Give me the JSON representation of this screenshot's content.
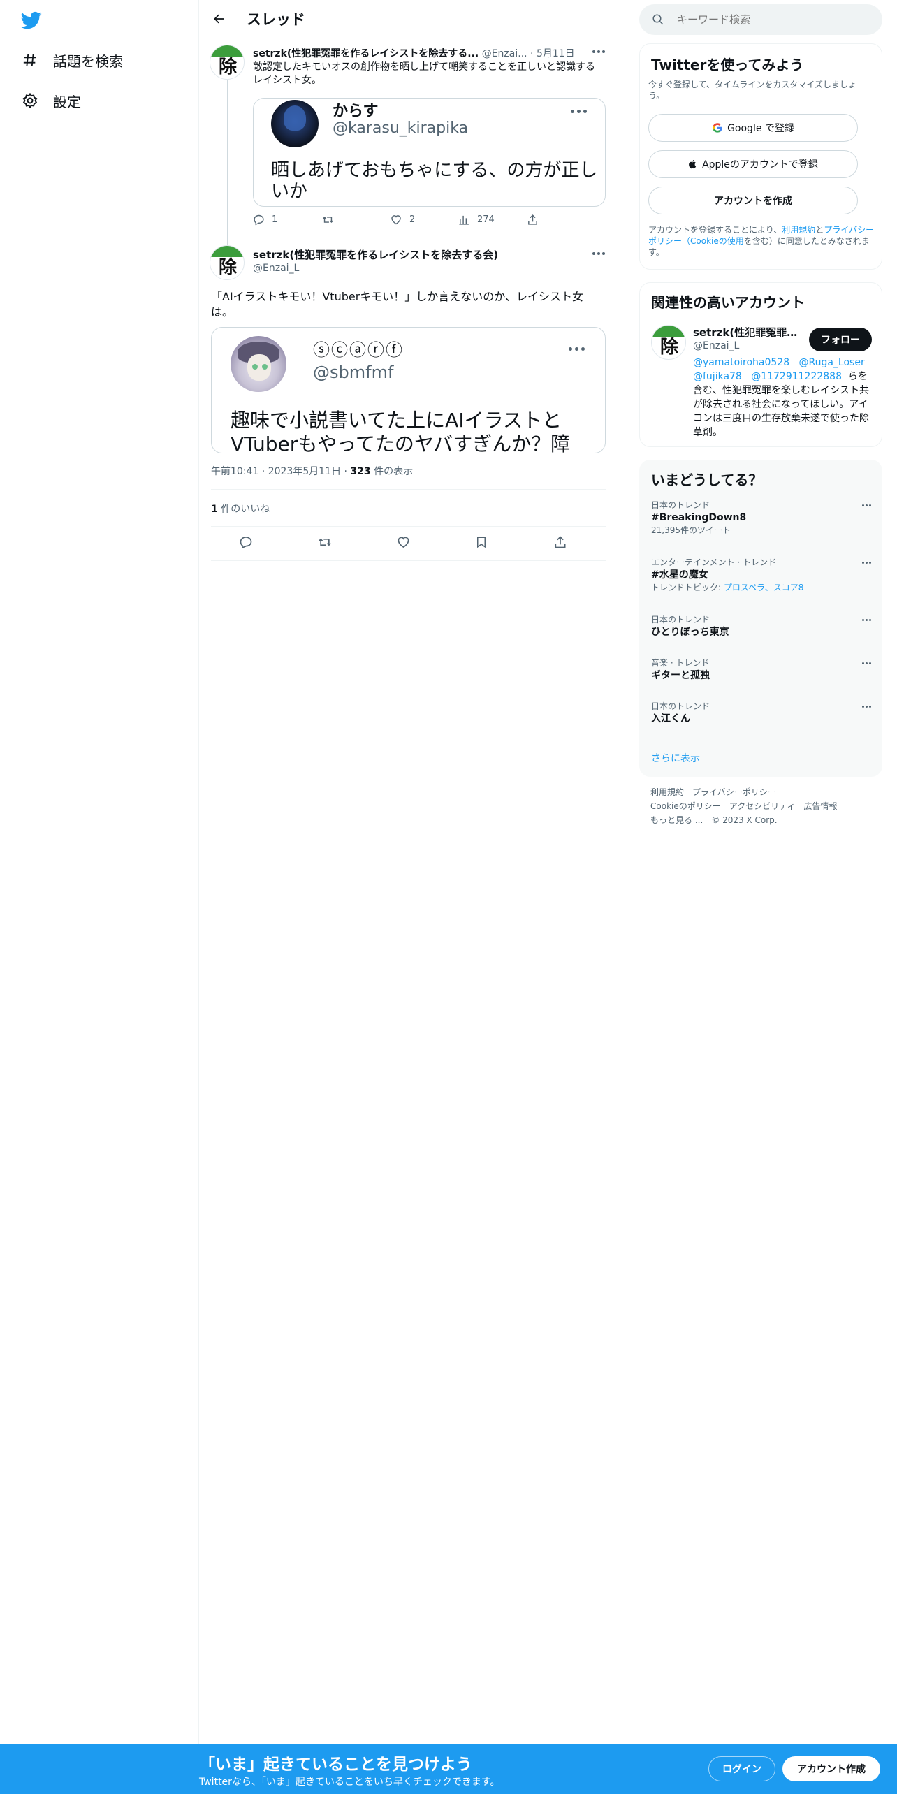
{
  "nav": {
    "logo_icon": "twitter-bird-icon",
    "items": [
      {
        "label": "話題を検索",
        "icon": "hashtag-icon"
      },
      {
        "label": "設定",
        "icon": "gear-icon"
      }
    ]
  },
  "thread": {
    "title": "スレッド",
    "tweet1": {
      "author_name": "setrzk(性犯罪冤罪を作るレイシストを除去する...",
      "handle": "@Enzai...",
      "date": "· 5月11日",
      "text": "敵認定したキモいオスの創作物を晒し上げて嘲笑することを正しいと認識するレイシスト女。",
      "quote": {
        "name": "からす",
        "handle": "@karasu_kirapika",
        "text": "晒しあげておもちゃにする、の方が正しいか"
      },
      "reply_count": "1",
      "retweet_count": "",
      "like_count": "2",
      "view_count": "274"
    },
    "tweet2": {
      "author_name": "setrzk(性犯罪冤罪を作るレイシストを除去する会)",
      "handle": "@Enzai_L",
      "text": "「AIイラストキモい！Vtuberキモい！」しか言えないのか、レイシスト女は。",
      "quote": {
        "name": "ⓢⓒⓐⓡⓕ",
        "handle": "@sbmfmf",
        "text": "趣味で小説書いてた上にAIイラストとVTuberもやってたのヤバすぎんか？障"
      },
      "time": "午前10:41",
      "date": "2023年5月11日",
      "views_num": "323",
      "views_label": "件の表示",
      "likes_num": "1",
      "likes_label": "件のいいね"
    }
  },
  "search": {
    "placeholder": "キーワード検索"
  },
  "signup_panel": {
    "title": "Twitterを使ってみよう",
    "subtitle": "今すぐ登録して、タイムラインをカスタマイズしましょう。",
    "google_label": "Google で登録",
    "apple_label": "Appleのアカウントで登録",
    "create_label": "アカウントを作成",
    "terms_prefix": "アカウントを登録することにより、",
    "terms_link1": "利用規約",
    "terms_mid1": "と",
    "terms_link2": "プライバシーポリシー（Cookieの使用",
    "terms_suffix": "を含む）に同意したとみなされます。"
  },
  "related": {
    "title": "関連性の高いアカウント",
    "name": "setrzk(性犯罪冤罪を...",
    "handle": "@Enzai_L",
    "follow_label": "フォロー",
    "bio_link1": "@yamatoiroha0528",
    "bio_link2": "@Ruga_Loser",
    "bio_link3": "@fujika78",
    "bio_link4": "@1172911222888",
    "bio_text": "らを含む、性犯罪冤罪を楽しむレイシスト共が除去される社会になってほしい。アイコンは三度目の生存放棄未遂で使った除草剤。"
  },
  "trends": {
    "title": "いまどうしてる？",
    "items": [
      {
        "category": "日本のトレンド",
        "name": "#BreakingDown8",
        "sub": "21,395件のツイート"
      },
      {
        "category": "エンターテインメント · トレンド",
        "name": "#水星の魔女",
        "sub_prefix": "トレンドトピック: ",
        "sub_link": "プロスペラ、スコア8"
      },
      {
        "category": "日本のトレンド",
        "name": "ひとりぼっち東京"
      },
      {
        "category": "音楽 · トレンド",
        "name": "ギターと孤独"
      },
      {
        "category": "日本のトレンド",
        "name": "入江くん"
      }
    ],
    "show_more": "さらに表示"
  },
  "footer": {
    "links": [
      "利用規約",
      "プライバシーポリシー",
      "Cookieのポリシー",
      "アクセシビリティ",
      "広告情報",
      "もっと見る ..."
    ],
    "copyright": "© 2023 X Corp."
  },
  "bottom_bar": {
    "title": "「いま」起きていることを見つけよう",
    "subtitle": "Twitterなら、「いま」起きていることをいち早くチェックできます。",
    "login_label": "ログイン",
    "signup_label": "アカウント作成"
  },
  "colors": {
    "brand_blue": "#1d9bf0",
    "text_primary": "#0f1419",
    "text_secondary": "#536471"
  }
}
